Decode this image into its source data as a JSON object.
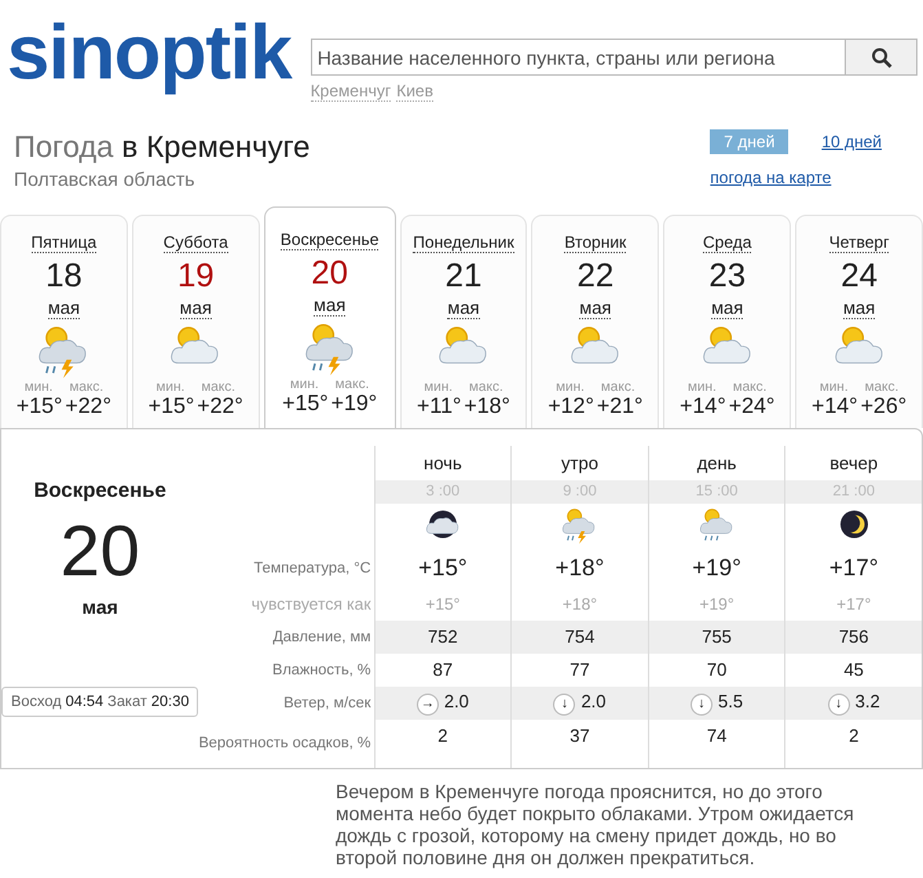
{
  "header": {
    "logo": "sinoptik",
    "search": {
      "placeholder": "Название населенного пункта, страны или региона"
    },
    "recent": [
      "Кременчуг",
      "Киев"
    ]
  },
  "title": {
    "prefix": "Погода",
    "city": "в Кременчуге",
    "region": "Полтавская область"
  },
  "period_tabs": [
    {
      "label": "7 дней",
      "selected": true
    },
    {
      "label": "10 дней",
      "selected": false
    }
  ],
  "map_link": "погода на карте",
  "days": [
    {
      "weekday": "Пятница",
      "date": "18",
      "month": "мая",
      "kind": "storm",
      "min_label": "мин.",
      "max_label": "макс.",
      "min": "+15°",
      "max": "+22°",
      "weekend": false,
      "selected": false
    },
    {
      "weekday": "Суббота",
      "date": "19",
      "month": "мая",
      "kind": "partly",
      "min_label": "мин.",
      "max_label": "макс.",
      "min": "+15°",
      "max": "+22°",
      "weekend": true,
      "selected": false
    },
    {
      "weekday": "Воскресенье",
      "date": "20",
      "month": "мая",
      "kind": "storm",
      "min_label": "мин.",
      "max_label": "макс.",
      "min": "+15°",
      "max": "+19°",
      "weekend": true,
      "selected": true
    },
    {
      "weekday": "Понедельник",
      "date": "21",
      "month": "мая",
      "kind": "partly",
      "min_label": "мин.",
      "max_label": "макс.",
      "min": "+11°",
      "max": "+18°",
      "weekend": false,
      "selected": false
    },
    {
      "weekday": "Вторник",
      "date": "22",
      "month": "мая",
      "kind": "partly",
      "min_label": "мин.",
      "max_label": "макс.",
      "min": "+12°",
      "max": "+21°",
      "weekend": false,
      "selected": false
    },
    {
      "weekday": "Среда",
      "date": "23",
      "month": "мая",
      "kind": "partly",
      "min_label": "мин.",
      "max_label": "макс.",
      "min": "+14°",
      "max": "+24°",
      "weekend": false,
      "selected": false
    },
    {
      "weekday": "Четверг",
      "date": "24",
      "month": "мая",
      "kind": "partly",
      "min_label": "мин.",
      "max_label": "макс.",
      "min": "+14°",
      "max": "+26°",
      "weekend": false,
      "selected": false
    }
  ],
  "detail": {
    "weekday": "Воскресенье",
    "date": "20",
    "month": "мая",
    "sun": {
      "sunrise_label": "Восход",
      "sunrise": "04:54",
      "sunset_label": "Закат",
      "sunset": "20:30"
    },
    "row_labels": [
      "Температура, °С",
      "чувствуется как",
      "Давление, мм",
      "Влажность, %",
      "Ветер, м/сек",
      "Вероятность осадков, %"
    ],
    "periods": [
      {
        "name": "ночь",
        "time": "3 :00",
        "kind": "cloudy-night",
        "temp": "+15°",
        "feels": "+15°",
        "pressure": "752",
        "humidity": "87",
        "wind_dir": "→",
        "wind": "2.0",
        "precip": "2"
      },
      {
        "name": "утро",
        "time": "9 :00",
        "kind": "storm",
        "temp": "+18°",
        "feels": "+18°",
        "pressure": "754",
        "humidity": "77",
        "wind_dir": "↓",
        "wind": "2.0",
        "precip": "37"
      },
      {
        "name": "день",
        "time": "15 :00",
        "kind": "rain",
        "temp": "+19°",
        "feels": "+19°",
        "pressure": "755",
        "humidity": "70",
        "wind_dir": "↓",
        "wind": "5.5",
        "precip": "74"
      },
      {
        "name": "вечер",
        "time": "21 :00",
        "kind": "clear-night",
        "temp": "+17°",
        "feels": "+17°",
        "pressure": "756",
        "humidity": "45",
        "wind_dir": "↓",
        "wind": "3.2",
        "precip": "2"
      }
    ]
  },
  "description": "Вечером в Кременчуге погода прояснится, но до этого момента небо будет покрыто облаками. Утром ожидается дождь с грозой, которому на смену придет дождь, но во второй половине дня он должен прекратиться."
}
